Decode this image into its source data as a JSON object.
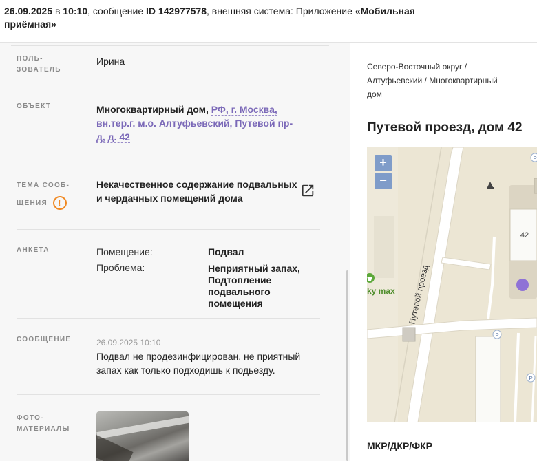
{
  "header": {
    "date": "26.09.2025",
    "in_word": " в ",
    "time": "10:10",
    "message_text": ", сообщение ",
    "id_label": "ID 142977578",
    "system_text": ", внешняя система: Приложение ",
    "app_name_part1": "«Мобильная",
    "app_name_part2": "приёмная»"
  },
  "rows": {
    "user": {
      "label_1": "ПОЛЬ-",
      "label_2": "ЗОВАТЕЛЬ",
      "value": "Ирина"
    },
    "object": {
      "label": "ОБЪЕКТ",
      "type": "Многоквартирный дом,",
      "addr_1": "РФ, г. Москва,",
      "addr_2": "вн.тер.г. м.о. Алтуфьевский, Путевой пр-",
      "addr_3": "д, д. 42"
    },
    "topic": {
      "label_1": "ТЕМА СООБ-",
      "label_2": "ЩЕНИЯ",
      "warn_symbol": "!",
      "value_1": "Некачественное содержание подвальных",
      "value_2": "и чердачных помещений дома"
    },
    "questionnaire": {
      "label": "АНКЕТА",
      "q1": "Помещение:",
      "a1": "Подвал",
      "q2": "Проблема:",
      "a2_1": "Неприятный запах,",
      "a2_2": "Подтопление",
      "a2_3": "подвального помещения"
    },
    "message": {
      "label": "СООБЩЕНИЕ",
      "datetime": "26.09.2025 10:10",
      "text_1": "Подвал не продезинфицирован, не приятный",
      "text_2": "запах как только подходишь к подьезду."
    },
    "photos": {
      "label_1": "ФОТО-",
      "label_2": "МАТЕРИАЛЫ"
    }
  },
  "right": {
    "crumb_1": "Северо-Восточный округ /",
    "crumb_2": "Алтуфьевский / Многоквартирный",
    "crumb_3": "дом",
    "title": "Путевой проезд, дом 42",
    "bottom_label": "МКР/ДКР/ФКР"
  },
  "map": {
    "zoom_in": "+",
    "zoom_out": "−",
    "street_label": "Путевой проезд",
    "house_number": "42",
    "shop_label": "ky max",
    "parking_1": "P",
    "parking_2": "P",
    "parking_3": "P",
    "marker_color": "#8f72d6"
  },
  "colors": {
    "link": "#7b69b8",
    "warning": "#f08a24",
    "map_button": "#7f9cc9"
  }
}
